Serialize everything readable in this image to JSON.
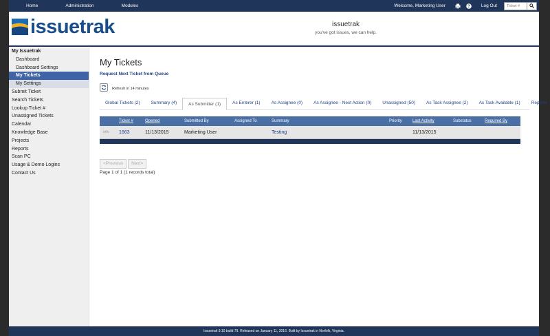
{
  "topbar": {
    "nav": [
      "Home",
      "Administration",
      "Modules"
    ],
    "welcome": "Welcome, Marketing User",
    "logout": "Log Out",
    "ticket_placeholder": "Ticket #"
  },
  "header": {
    "logo_text": "issuetrak",
    "title": "issuetrak",
    "tagline": "you've got issues, we can help."
  },
  "sidebar": {
    "items": [
      {
        "label": "My Issuetrak",
        "kind": "head"
      },
      {
        "label": "Dashboard",
        "kind": "sub"
      },
      {
        "label": "Dashboard Settings",
        "kind": "sub"
      },
      {
        "label": "My Tickets",
        "kind": "active"
      },
      {
        "label": "My Settings",
        "kind": "subsel"
      },
      {
        "label": "Submit Ticket",
        "kind": "top"
      },
      {
        "label": "Search Tickets",
        "kind": "top"
      },
      {
        "label": "Lookup Ticket #",
        "kind": "top"
      },
      {
        "label": "Unassigned Tickets",
        "kind": "top"
      },
      {
        "label": "Calendar",
        "kind": "top"
      },
      {
        "label": "Knowledge Base",
        "kind": "top"
      },
      {
        "label": "Projects",
        "kind": "top"
      },
      {
        "label": "Reports",
        "kind": "top"
      },
      {
        "label": "Scan PC",
        "kind": "top"
      },
      {
        "label": "Usage & Demo Logins",
        "kind": "top"
      },
      {
        "label": "Contact Us",
        "kind": "top"
      }
    ]
  },
  "main": {
    "title": "My Tickets",
    "request_link": "Request Next Ticket from Queue",
    "refresh_text": "Refresh in 14 minutes",
    "tabs": [
      {
        "label": "Global Tickets (2)"
      },
      {
        "label": "Summary (4)"
      },
      {
        "label": "As Submitter (1)",
        "selected": true
      },
      {
        "label": "As Enterer (1)"
      },
      {
        "label": "As Assignee (0)"
      },
      {
        "label": "As Assignee - Next Action (0)"
      },
      {
        "label": "Unassigned (50)"
      },
      {
        "label": "As Task Assignee (2)"
      },
      {
        "label": "As Task Available (1)"
      },
      {
        "label": "Reports"
      }
    ],
    "grid": {
      "columns": [
        "Ticket #",
        "Opened",
        "Submitted By",
        "Assigned To",
        "Summary",
        "Priority",
        "Last Activity",
        "Substatus",
        "Required By"
      ],
      "row": {
        "info": "info",
        "ticket": "1663",
        "opened": "11/13/2015",
        "submitted_by": "Marketing User",
        "assigned_to": "",
        "summary": "Testing",
        "priority": "",
        "last_activity": "11/13/2015",
        "substatus": "",
        "required_by": ""
      }
    },
    "pager": {
      "prev": "<Previous",
      "next": "Next>",
      "info": "Page 1 of 1 (1 records total)"
    }
  },
  "footer": {
    "text": "Issuetrak 9.10 build 79. Released on January 11, 2016. Built by Issuetrak in Norfolk, Virginia."
  },
  "colors": {
    "navy": "#1f3559",
    "accent": "#3f63a5",
    "link": "#1f3f88",
    "grid_header": "#4a6fa5"
  }
}
